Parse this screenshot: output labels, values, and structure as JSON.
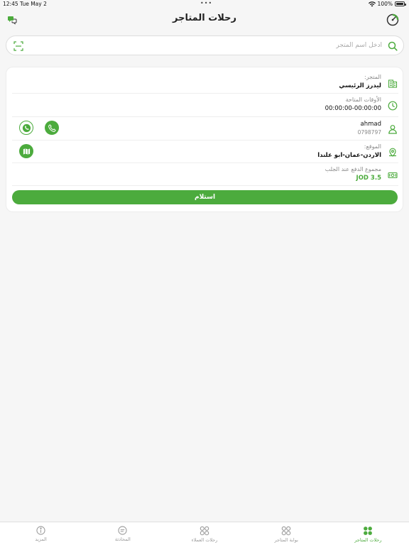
{
  "status_bar": {
    "time": "12:45",
    "date": "Tue May 2",
    "battery": "100%"
  },
  "header": {
    "title": "رحلات المتاجر"
  },
  "search": {
    "placeholder": "ادخل اسم المتجر",
    "value": ""
  },
  "card": {
    "store": {
      "label": "المتجر:",
      "value": "ليدرز الرئيسي"
    },
    "times": {
      "label": "الأوقات المتاحة",
      "value": "00:00:00-00:00:00"
    },
    "customer": {
      "name": "ahmad",
      "phone": "0798797"
    },
    "location": {
      "label": "الموقع:",
      "value": "الاردن-عمان-ابو علندا"
    },
    "payment": {
      "label": "مجموع الدفع عند الجلب",
      "value": "JOD 3.5"
    },
    "receive_label": "استلام"
  },
  "tabs": [
    {
      "label": "رحلات المتاجر",
      "icon": "grid-icon",
      "active": true
    },
    {
      "label": "بوابة المتاجر",
      "icon": "grid-icon",
      "active": false
    },
    {
      "label": "رحلات العملاء",
      "icon": "grid-icon",
      "active": false
    },
    {
      "label": "المحادثة",
      "icon": "chat-icon",
      "active": false
    },
    {
      "label": "المزيد",
      "icon": "info-icon",
      "active": false
    }
  ],
  "colors": {
    "accent": "#4cab3d",
    "background": "#f6f6f6"
  }
}
